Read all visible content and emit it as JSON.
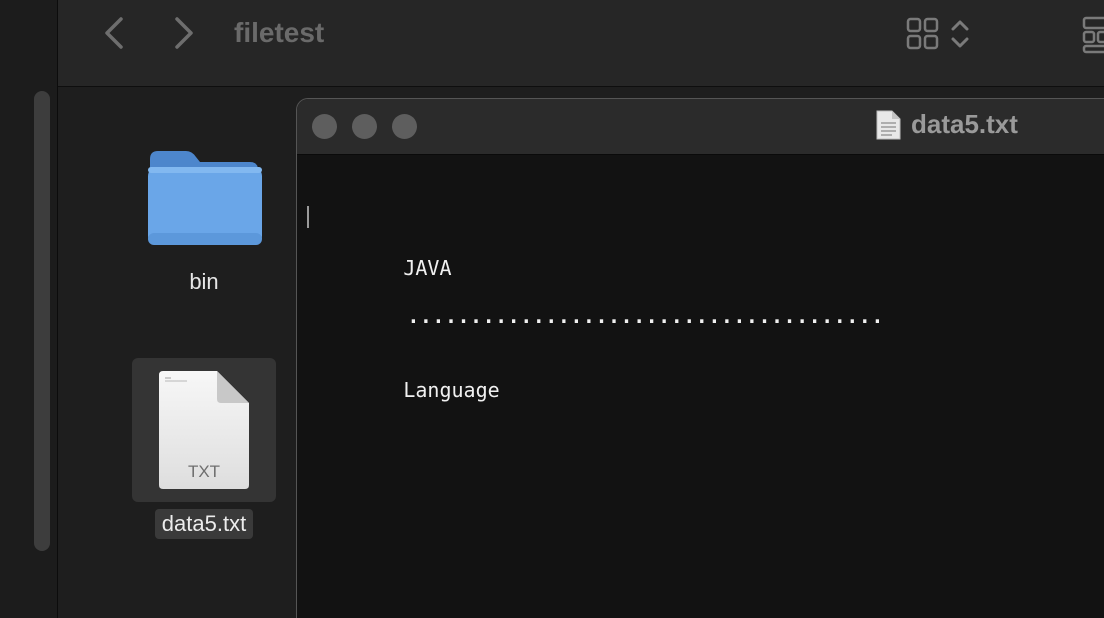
{
  "finder": {
    "title": "filetest",
    "items": [
      {
        "label": "bin",
        "kind": "folder-icon"
      },
      {
        "label": "data5.txt",
        "kind": "text-file-icon",
        "type_label": "TXT"
      }
    ]
  },
  "editor": {
    "title": "data5.txt",
    "lines": [
      "JAVA",
      "......................................",
      "Language"
    ]
  },
  "colors": {
    "folder": "#6aa6e8",
    "background": "#1e1e1e",
    "editor_bg": "#121212"
  }
}
